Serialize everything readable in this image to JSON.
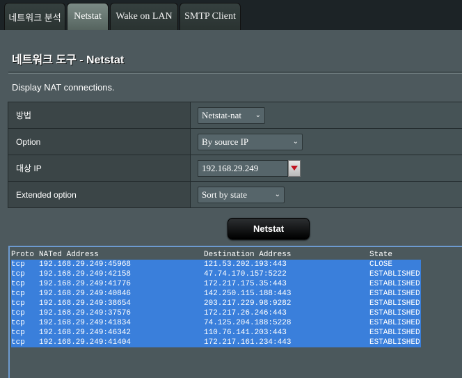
{
  "tabs": [
    {
      "label": "네트워크 분석",
      "active": false
    },
    {
      "label": "Netstat",
      "active": true
    },
    {
      "label": "Wake on LAN",
      "active": false
    },
    {
      "label": "SMTP Client",
      "active": false
    }
  ],
  "page": {
    "title": "네트워크 도구 - Netstat",
    "description": "Display NAT connections."
  },
  "form": {
    "method": {
      "label": "방법",
      "value": "Netstat-nat"
    },
    "option": {
      "label": "Option",
      "value": "By source IP"
    },
    "target_ip": {
      "label": "대상 IP",
      "value": "192.168.29.249"
    },
    "extended": {
      "label": "Extended option",
      "value": "Sort by state"
    }
  },
  "run_button": "Netstat",
  "output": {
    "headers": {
      "proto": "Proto",
      "nat": "NATed Address",
      "dst": "Destination Address",
      "state": "State"
    },
    "rows": [
      {
        "proto": "tcp",
        "nat": "192.168.29.249:45968",
        "dst": "121.53.202.193:443",
        "state": "CLOSE"
      },
      {
        "proto": "tcp",
        "nat": "192.168.29.249:42158",
        "dst": "47.74.170.157:5222",
        "state": "ESTABLISHED"
      },
      {
        "proto": "tcp",
        "nat": "192.168.29.249:41776",
        "dst": "172.217.175.35:443",
        "state": "ESTABLISHED"
      },
      {
        "proto": "tcp",
        "nat": "192.168.29.249:40846",
        "dst": "142.250.115.188:443",
        "state": "ESTABLISHED"
      },
      {
        "proto": "tcp",
        "nat": "192.168.29.249:38654",
        "dst": "203.217.229.98:9282",
        "state": "ESTABLISHED"
      },
      {
        "proto": "tcp",
        "nat": "192.168.29.249:37576",
        "dst": "172.217.26.246:443",
        "state": "ESTABLISHED"
      },
      {
        "proto": "tcp",
        "nat": "192.168.29.249:41834",
        "dst": "74.125.204.188:5228",
        "state": "ESTABLISHED"
      },
      {
        "proto": "tcp",
        "nat": "192.168.29.249:46342",
        "dst": "110.76.141.203:443",
        "state": "ESTABLISHED"
      },
      {
        "proto": "tcp",
        "nat": "192.168.29.249:41404",
        "dst": "172.217.161.234:443",
        "state": "ESTABLISHED"
      }
    ]
  },
  "colors": {
    "selection": "#3a7fdb",
    "background": "#4d595d",
    "tabbar": "#1c2326"
  }
}
